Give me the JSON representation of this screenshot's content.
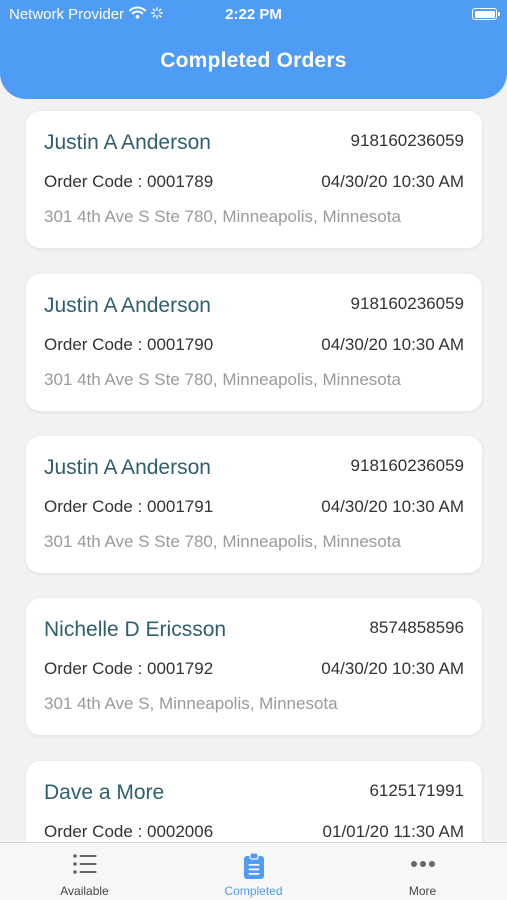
{
  "status_bar": {
    "carrier": "Network Provider",
    "time": "2:22 PM"
  },
  "header": {
    "title": "Completed Orders"
  },
  "orders": [
    {
      "name": "Justin A Anderson",
      "phone": "918160236059",
      "order_code": "Order Code : 0001789",
      "datetime": "04/30/20 10:30 AM",
      "address": "301 4th Ave S Ste 780, Minneapolis, Minnesota"
    },
    {
      "name": "Justin A Anderson",
      "phone": "918160236059",
      "order_code": "Order Code : 0001790",
      "datetime": "04/30/20 10:30 AM",
      "address": "301 4th Ave S Ste 780, Minneapolis, Minnesota"
    },
    {
      "name": "Justin A Anderson",
      "phone": "918160236059",
      "order_code": "Order Code : 0001791",
      "datetime": "04/30/20 10:30 AM",
      "address": "301 4th Ave S Ste 780, Minneapolis, Minnesota"
    },
    {
      "name": "Nichelle D Ericsson",
      "phone": "8574858596",
      "order_code": "Order Code : 0001792",
      "datetime": "04/30/20 10:30 AM",
      "address": "301 4th Ave S, Minneapolis, Minnesota"
    },
    {
      "name": "Dave a More",
      "phone": "6125171991",
      "order_code": "Order Code : 0002006",
      "datetime": "01/01/20 11:30 AM",
      "address": ""
    }
  ],
  "tabbar": {
    "tabs": [
      {
        "label": "Available",
        "icon": "list-icon",
        "active": false
      },
      {
        "label": "Completed",
        "icon": "clipboard-icon",
        "active": true
      },
      {
        "label": "More",
        "icon": "more-dots-icon",
        "active": false
      }
    ]
  },
  "colors": {
    "accent": "#4f9cf6",
    "name_text": "#2f5f6e",
    "address_text": "#9a9a9a"
  }
}
